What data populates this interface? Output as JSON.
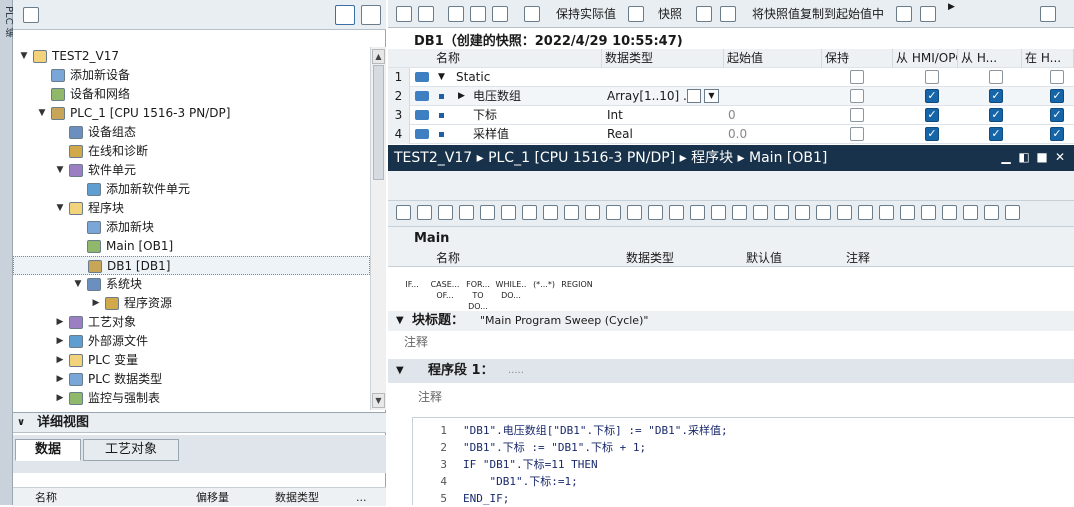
{
  "left_strip": {
    "label": "PLC 编"
  },
  "tree": {
    "items": [
      {
        "label": "TEST2_V17",
        "arrow": "▼",
        "level": 0
      },
      {
        "label": "添加新设备",
        "arrow": "",
        "level": 1
      },
      {
        "label": "设备和网络",
        "arrow": "",
        "level": 1
      },
      {
        "label": "PLC_1 [CPU 1516-3 PN/DP]",
        "arrow": "▼",
        "level": 1
      },
      {
        "label": "设备组态",
        "arrow": "",
        "level": 2
      },
      {
        "label": "在线和诊断",
        "arrow": "",
        "level": 2
      },
      {
        "label": "软件单元",
        "arrow": "▼",
        "level": 2
      },
      {
        "label": "添加新软件单元",
        "arrow": "",
        "level": 3
      },
      {
        "label": "程序块",
        "arrow": "▼",
        "level": 2
      },
      {
        "label": "添加新块",
        "arrow": "",
        "level": 3
      },
      {
        "label": "Main [OB1]",
        "arrow": "",
        "level": 3
      },
      {
        "label": "DB1 [DB1]",
        "arrow": "",
        "level": 3
      },
      {
        "label": "系统块",
        "arrow": "▼",
        "level": 3
      },
      {
        "label": "程序资源",
        "arrow": "▶",
        "level": 4
      },
      {
        "label": "工艺对象",
        "arrow": "▶",
        "level": 2
      },
      {
        "label": "外部源文件",
        "arrow": "▶",
        "level": 2
      },
      {
        "label": "PLC 变量",
        "arrow": "▶",
        "level": 2
      },
      {
        "label": "PLC 数据类型",
        "arrow": "▶",
        "level": 2
      },
      {
        "label": "监控与强制表",
        "arrow": "▶",
        "level": 2
      }
    ]
  },
  "detail": {
    "title": "详细视图",
    "tabs": [
      "数据",
      "工艺对象"
    ],
    "columns": [
      "名称",
      "偏移量",
      "数据类型",
      "..."
    ]
  },
  "db": {
    "toolbar": {
      "keep_actual": "保持实际值",
      "snapshot": "快照",
      "copy_snapshot": "将快照值复制到起始值中"
    },
    "title": "DB1（创建的快照：2022/4/29 10:55:47)",
    "columns": [
      "名称",
      "数据类型",
      "起始值",
      "保持",
      "从 HMI/OPC..",
      "从 H...",
      "在 H..."
    ],
    "rows": [
      {
        "num": "1",
        "name": "Static",
        "type": "",
        "start": "",
        "retain": false,
        "hmi1": false,
        "hmi2": false,
        "hmi3": false
      },
      {
        "num": "2",
        "name": "电压数组",
        "type": "Array[1..10] ...",
        "start": "",
        "retain": false,
        "hmi1": true,
        "hmi2": true,
        "hmi3": true
      },
      {
        "num": "3",
        "name": "下标",
        "type": "Int",
        "start": "0",
        "retain": false,
        "hmi1": true,
        "hmi2": true,
        "hmi3": true
      },
      {
        "num": "4",
        "name": "采样值",
        "type": "Real",
        "start": "0.0",
        "retain": false,
        "hmi1": true,
        "hmi2": true,
        "hmi3": true
      }
    ]
  },
  "ob": {
    "breadcrumb": "TEST2_V17 ▸ PLC_1 [CPU 1516-3 PN/DP] ▸ 程序块 ▸ Main [OB1]",
    "section": "Main",
    "iface_columns": [
      "名称",
      "数据类型",
      "默认值",
      "注释"
    ],
    "snippets": [
      {
        "l1": "IF...",
        "l2": ""
      },
      {
        "l1": "CASE...",
        "l2": "OF..."
      },
      {
        "l1": "FOR...",
        "l2": "TO DO..."
      },
      {
        "l1": "WHILE..",
        "l2": "DO..."
      },
      {
        "l1": "(*...*)",
        "l2": ""
      },
      {
        "l1": "REGION",
        "l2": ""
      }
    ],
    "block_title_label": "块标题：",
    "block_title_value": "\"Main Program Sweep (Cycle)\"",
    "block_comment": "注释",
    "network_label": "程序段 1：",
    "network_dots": ".....",
    "network_comment": "注释",
    "code": [
      {
        "n": "1",
        "text": "\"DB1\".电压数组[\"DB1\".下标] := \"DB1\".采样值;"
      },
      {
        "n": "2",
        "text": "\"DB1\".下标 := \"DB1\".下标 + 1;"
      },
      {
        "n": "3",
        "text": "IF \"DB1\".下标=11 THEN"
      },
      {
        "n": "4",
        "text": "    \"DB1\".下标:=1;"
      },
      {
        "n": "5",
        "text": "END_IF;"
      }
    ]
  },
  "colors": {
    "title_bar": "#17324a",
    "check_on": "#1565a8",
    "panel_bg": "#e9eef2"
  }
}
